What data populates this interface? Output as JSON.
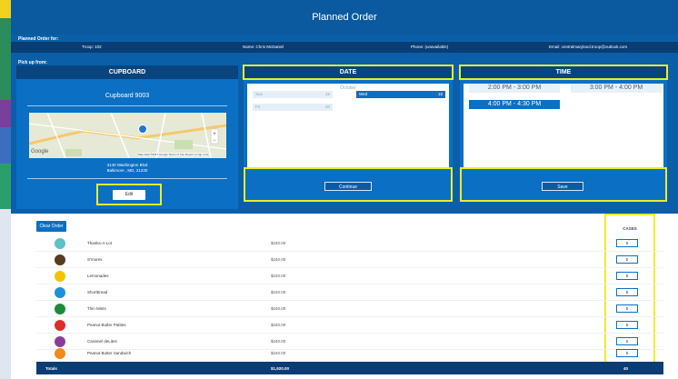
{
  "title": "Planned Order",
  "order_for_label": "Planned Order for:",
  "info": {
    "troop": "Troop: 102",
    "name": "Name: Chris McDaniel",
    "phone": "Phone: (unavailable)",
    "email": "Email: centralmaryland.troop@outlook.com"
  },
  "pickup_label": "Pick up from:",
  "cupboard": {
    "heading": "CUPBOARD",
    "name": "Cupboard 9003",
    "map_attribution": "Map data ©2017 Google   Terms of Use   Report a map error",
    "map_logo": "Google",
    "address_line1": "3140 Washington Blvd",
    "address_line2": "Baltimore , MD, 21230",
    "edit_label": "Edit"
  },
  "date": {
    "heading": "DATE",
    "month": "October",
    "days": [
      {
        "label": "Sun",
        "num": "15",
        "selected": false
      },
      {
        "label": "Wed",
        "num": "18",
        "selected": true
      },
      {
        "label": "Fri",
        "num": "20",
        "selected": false
      }
    ],
    "continue_label": "Continue"
  },
  "time": {
    "heading": "TIME",
    "slots": [
      {
        "label": "2:00 PM - 3:00 PM",
        "selected": false
      },
      {
        "label": "3:00 PM - 4:00 PM",
        "selected": false
      },
      {
        "label": "4:00 PM - 4:30 PM",
        "selected": true
      }
    ],
    "save_label": "Save"
  },
  "table": {
    "clear_label": "Clear Order",
    "cases_header": "CASES",
    "rows": [
      {
        "name": "Thanks-A-Lot",
        "price": "$240.00",
        "qty": "5",
        "color": "#5fc1c4"
      },
      {
        "name": "S'mores",
        "price": "$240.00",
        "qty": "5",
        "color": "#5a3a22"
      },
      {
        "name": "Lemonades",
        "price": "$240.00",
        "qty": "5",
        "color": "#f2c400"
      },
      {
        "name": "Shortbread",
        "price": "$240.00",
        "qty": "5",
        "color": "#1e90d8"
      },
      {
        "name": "Thin Mints",
        "price": "$240.00",
        "qty": "5",
        "color": "#1f8a3a"
      },
      {
        "name": "Peanut Butter Patties",
        "price": "$240.00",
        "qty": "5",
        "color": "#e02b2b"
      },
      {
        "name": "Caramel deLites",
        "price": "$240.00",
        "qty": "5",
        "color": "#8a3c9a"
      },
      {
        "name": "Peanut Butter Sandwich",
        "price": "$240.00",
        "qty": "5",
        "color": "#f08a1c"
      }
    ],
    "totals_label": "Totals",
    "totals_price": "$1,920.00",
    "totals_qty": "40"
  }
}
